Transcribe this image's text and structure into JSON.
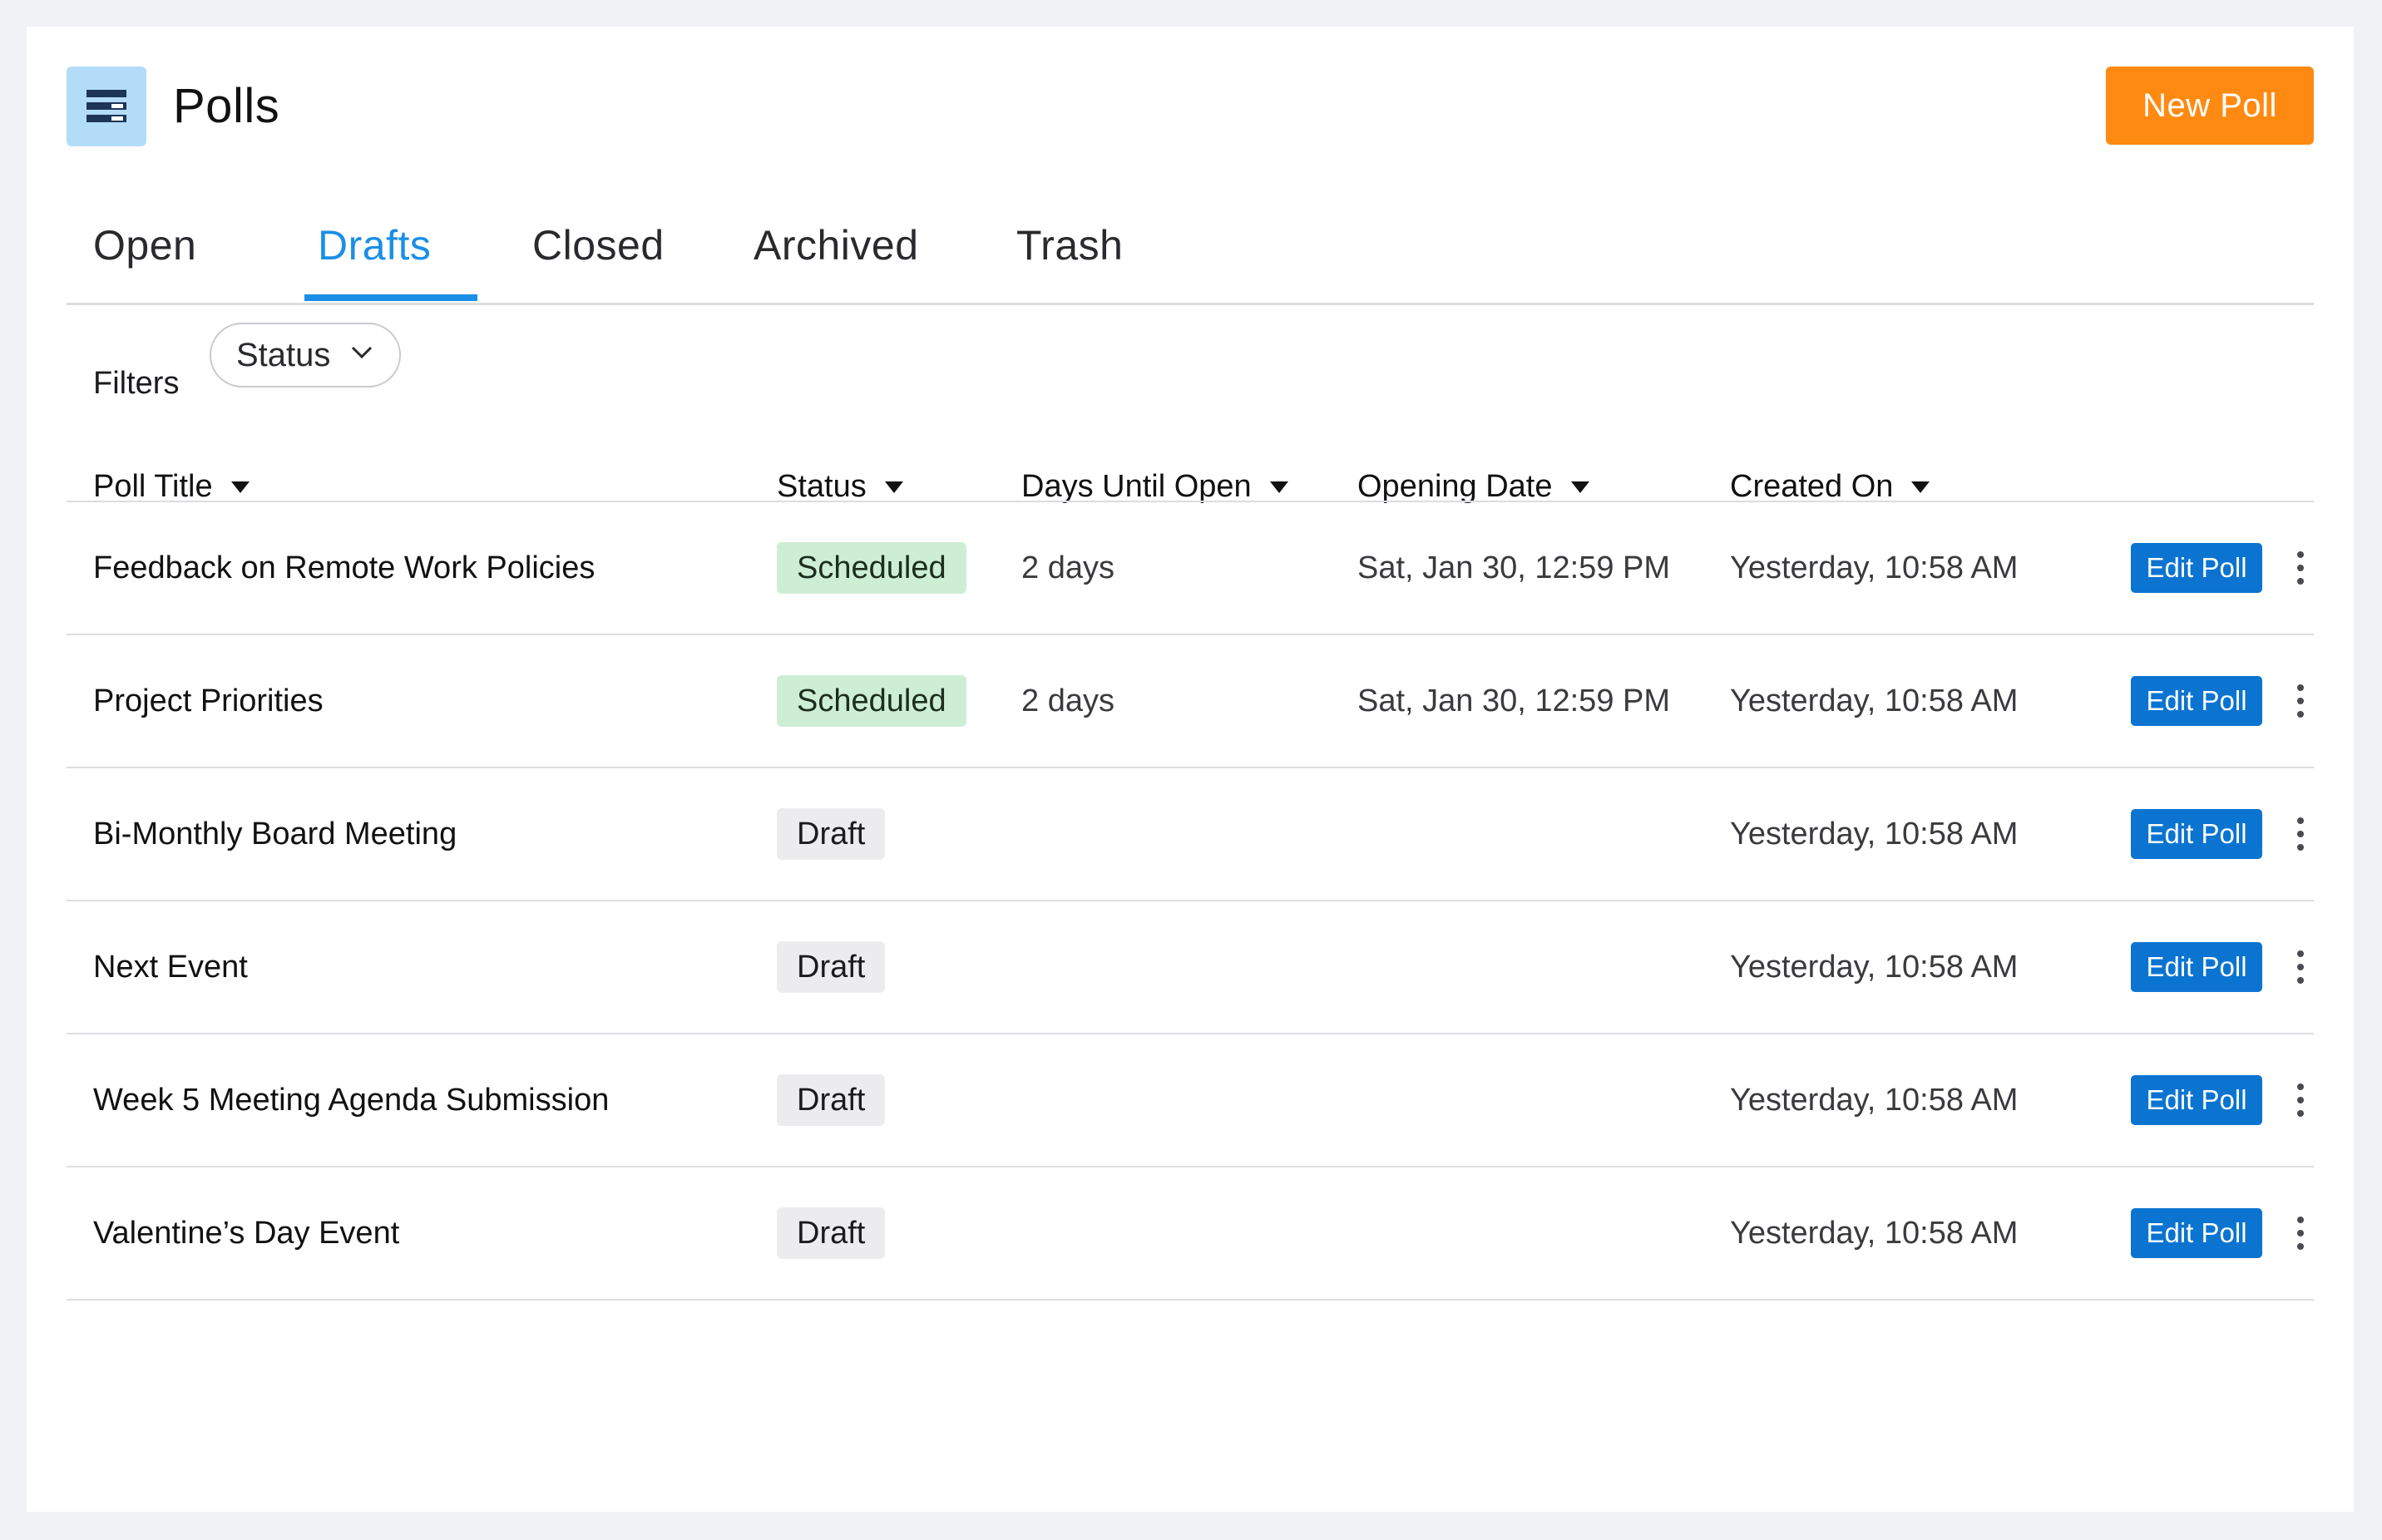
{
  "header": {
    "icon": "polls-list-icon",
    "title": "Polls",
    "new_poll_label": "New Poll",
    "accent": "#ff8a12"
  },
  "tabs": [
    {
      "label": "Open",
      "active": false
    },
    {
      "label": "Drafts",
      "active": true
    },
    {
      "label": "Closed",
      "active": false
    },
    {
      "label": "Archived",
      "active": false
    },
    {
      "label": "Trash",
      "active": false
    }
  ],
  "filters": {
    "label": "Filters",
    "status_label": "Status"
  },
  "table": {
    "columns": [
      "Poll Title",
      "Status",
      "Days Until Open",
      "Opening Date",
      "Created On"
    ],
    "edit_label": "Edit Poll",
    "rows": [
      {
        "title": "Feedback on Remote Work Policies",
        "status": "Scheduled",
        "days": "2 days",
        "opening": "Sat, Jan 30, 12:59 PM",
        "created": "Yesterday, 10:58 AM"
      },
      {
        "title": "Project Priorities",
        "status": "Scheduled",
        "days": "2 days",
        "opening": "Sat, Jan 30, 12:59 PM",
        "created": "Yesterday, 10:58 AM"
      },
      {
        "title": "Bi-Monthly Board Meeting",
        "status": "Draft",
        "days": "",
        "opening": "",
        "created": "Yesterday, 10:58 AM"
      },
      {
        "title": "Next Event",
        "status": "Draft",
        "days": "",
        "opening": "",
        "created": "Yesterday, 10:58 AM"
      },
      {
        "title": "Week 5 Meeting Agenda Submission",
        "status": "Draft",
        "days": "",
        "opening": "",
        "created": "Yesterday, 10:58 AM"
      },
      {
        "title": "Valentine’s Day Event",
        "status": "Draft",
        "days": "",
        "opening": "",
        "created": "Yesterday, 10:58 AM"
      }
    ]
  },
  "colors": {
    "tab_active": "#1a8fe6",
    "edit_button": "#0b74d1",
    "scheduled_badge": "#cdeed4",
    "draft_badge": "#ececee"
  }
}
